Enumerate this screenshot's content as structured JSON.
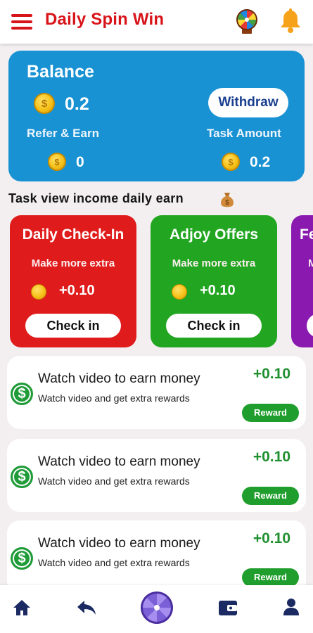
{
  "app_bar": {
    "title": "Daily Spin Win",
    "icons": [
      "menu-icon",
      "spin-wheel-icon",
      "bell-icon"
    ],
    "accent_color": "#d8141b"
  },
  "balance_card": {
    "title": "Balance",
    "balance": "0.2",
    "withdraw_label": "Withdraw",
    "refer_label": "Refer & Earn",
    "refer_value": "0",
    "task_label": "Task Amount",
    "task_value": "0.2",
    "card_color": "#1992d4"
  },
  "section": {
    "title": "Task view income daily earn",
    "icon": "money-bag-icon"
  },
  "offers": [
    {
      "title": "Daily Check-In",
      "subtitle": "Make more extra",
      "amount": "+0.10",
      "button": "Check in",
      "color": "#e01b1b"
    },
    {
      "title": "Adjoy Offers",
      "subtitle": "Make more extra",
      "amount": "+0.10",
      "button": "Check in",
      "color": "#22a622"
    },
    {
      "title": "Fe",
      "subtitle": "M",
      "color": "#8a19b0"
    }
  ],
  "tasks": [
    {
      "title": "Watch video to earn money",
      "subtitle": "Watch video and get extra rewards",
      "amount": "+0.10",
      "button": "Reward"
    },
    {
      "title": "Watch video to earn money",
      "subtitle": "Watch video and get extra rewards",
      "amount": "+0.10",
      "button": "Reward"
    },
    {
      "title": "Watch video to earn money",
      "subtitle": "Watch video and get extra rewards",
      "amount": "+0.10",
      "button": "Reward"
    }
  ],
  "bottom_nav": {
    "items": [
      "home-icon",
      "back-arrow-icon",
      "spin-wheel-icon",
      "wallet-icon",
      "profile-icon"
    ]
  }
}
